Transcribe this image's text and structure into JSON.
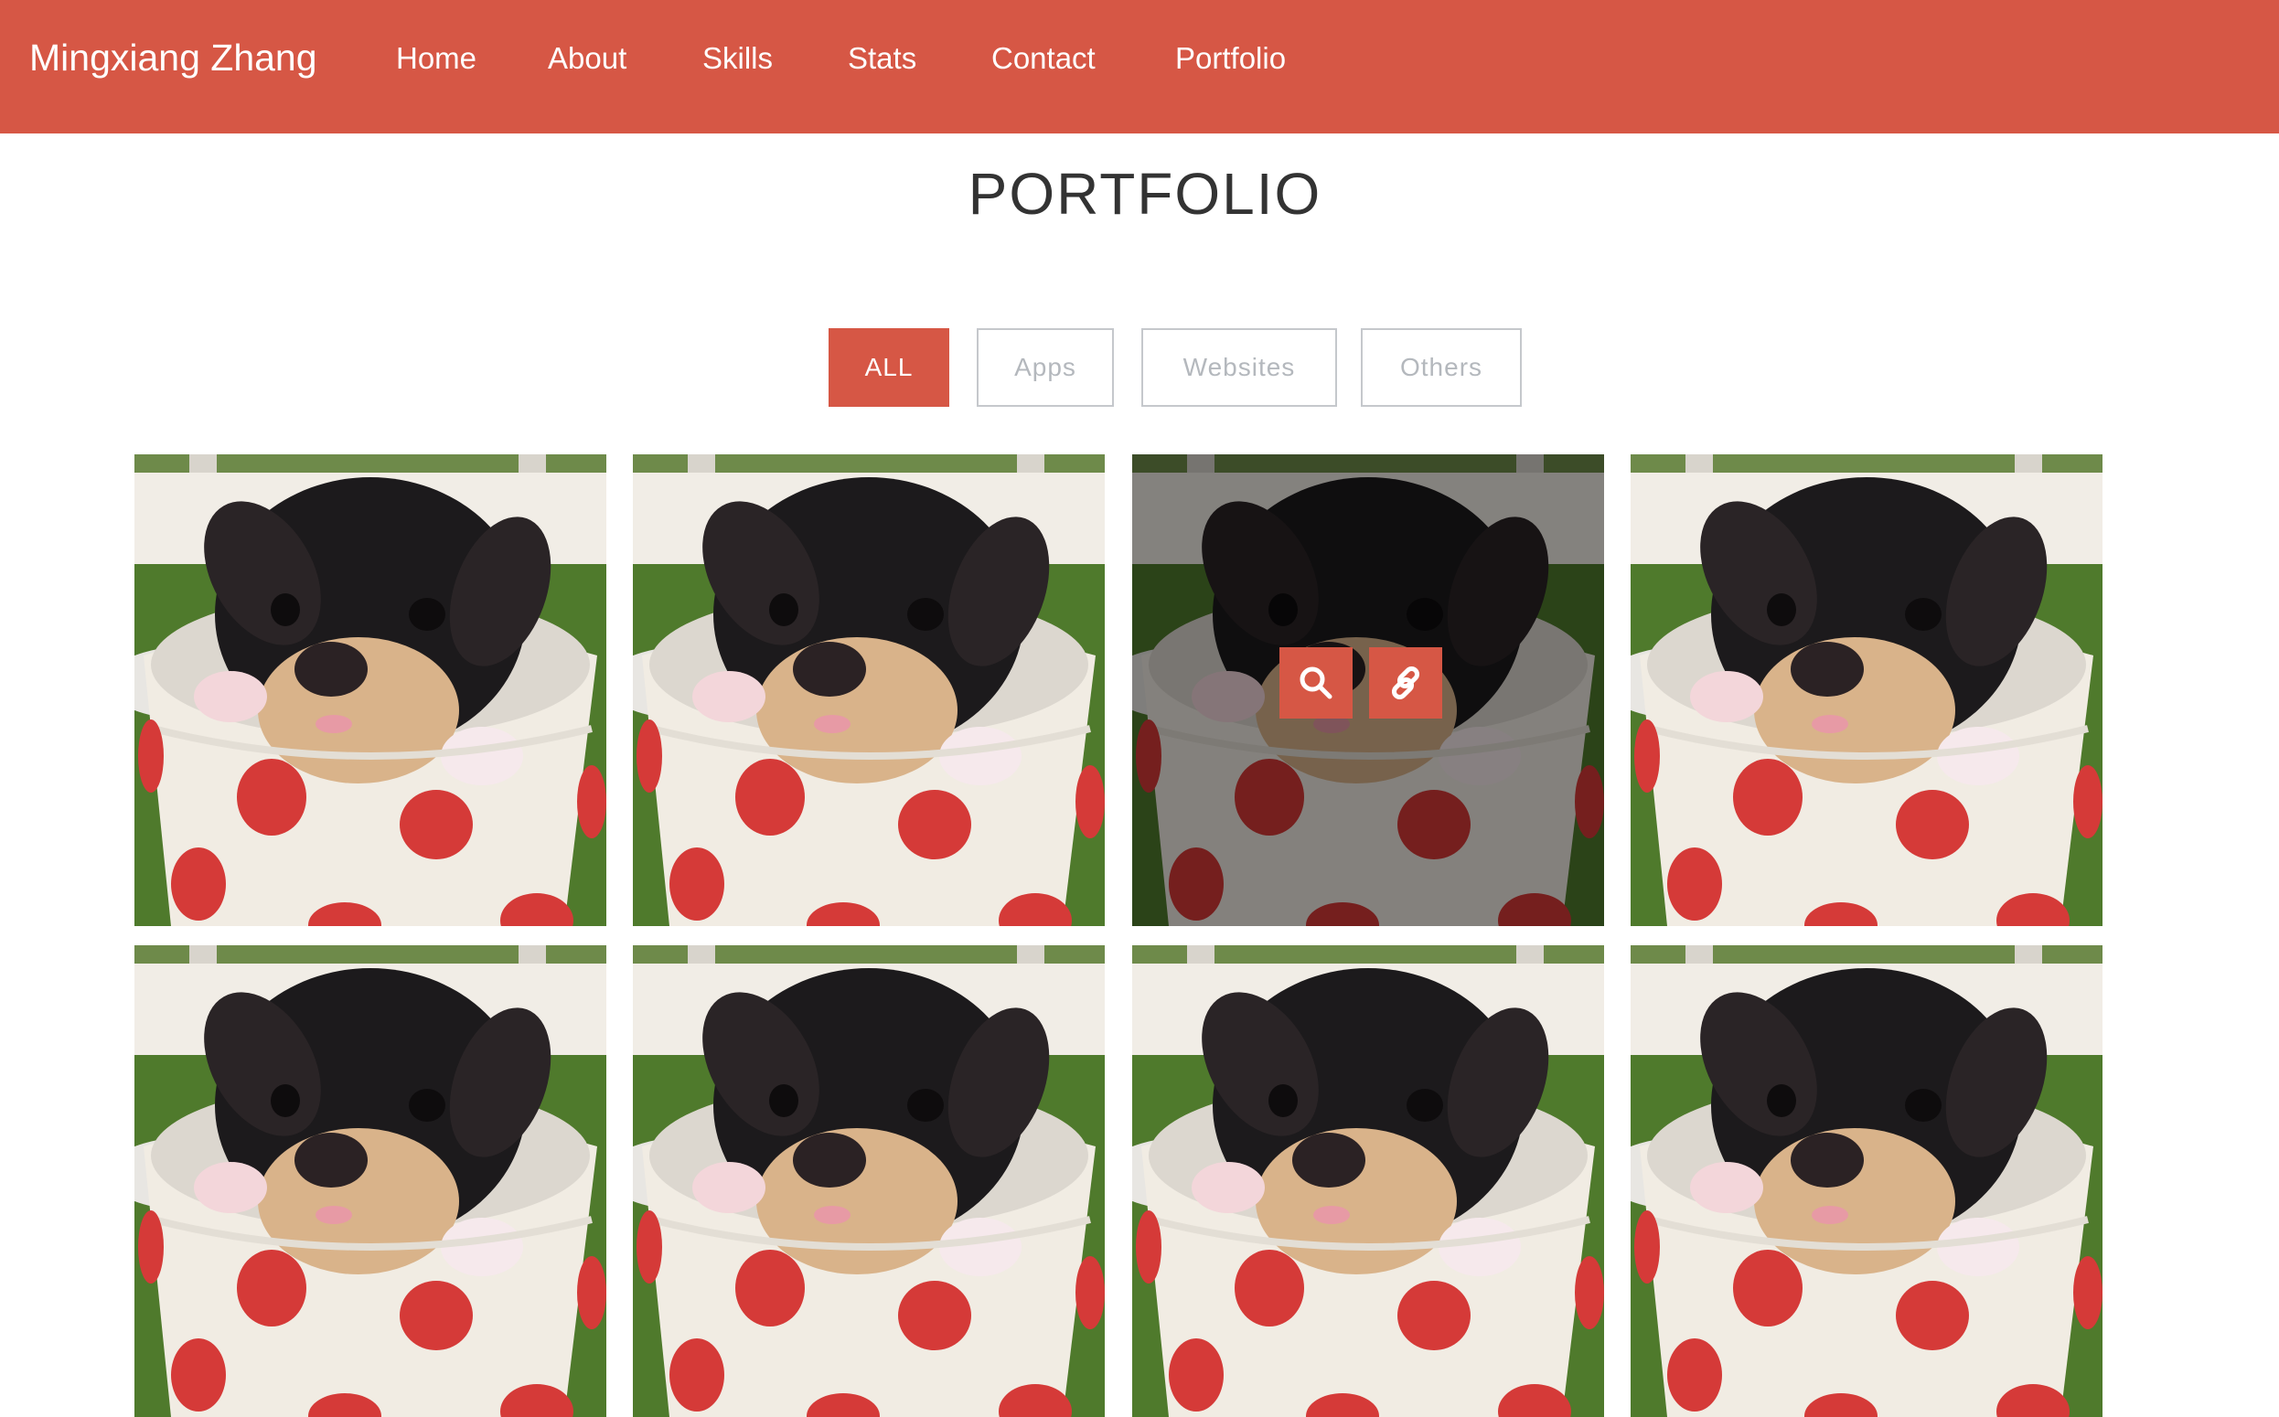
{
  "nav": {
    "brand": "Mingxiang Zhang",
    "items": [
      {
        "label": "Home"
      },
      {
        "label": "About"
      },
      {
        "label": "Skills"
      },
      {
        "label": "Stats"
      },
      {
        "label": "Contact"
      },
      {
        "label": "Portfolio"
      }
    ]
  },
  "section": {
    "title": "PORTFOLIO"
  },
  "filters": [
    {
      "label": "ALL",
      "active": true
    },
    {
      "label": "Apps",
      "active": false
    },
    {
      "label": "Websites",
      "active": false
    },
    {
      "label": "Others",
      "active": false
    }
  ],
  "portfolio": {
    "item_count_visible": 8,
    "hovered_item_index": 2,
    "overlay_icons": [
      "search-icon",
      "link-icon"
    ]
  },
  "colors": {
    "accent": "#d65745",
    "title": "#333333",
    "filter_inactive": "#b4b8bd"
  }
}
